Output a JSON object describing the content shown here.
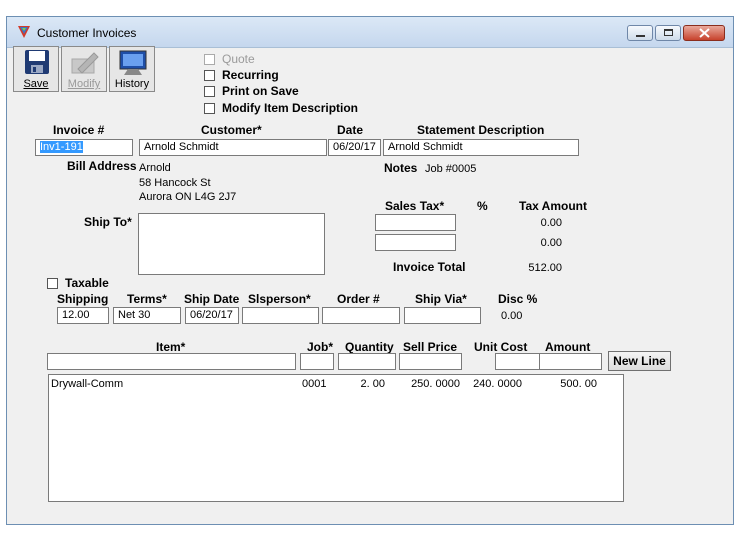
{
  "window": {
    "title": "Customer Invoices"
  },
  "toolbar": {
    "save_label": "Save",
    "modify_label": "Modify",
    "history_label": "History"
  },
  "options": {
    "quote": "Quote",
    "recurring": "Recurring",
    "print_on_save": "Print on Save",
    "modify_item_description": "Modify Item Description"
  },
  "headers": {
    "invoice_no": "Invoice #",
    "customer": "Customer*",
    "date": "Date",
    "statement_description": "Statement Description",
    "bill_address": "Bill Address",
    "notes": "Notes",
    "ship_to": "Ship To*",
    "sales_tax": "Sales Tax*",
    "percent": "%",
    "tax_amount": "Tax Amount",
    "invoice_total": "Invoice Total",
    "taxable": "Taxable",
    "shipping": "Shipping",
    "terms": "Terms*",
    "ship_date": "Ship Date",
    "slsperson": "Slsperson*",
    "order_no": "Order #",
    "ship_via": "Ship Via*",
    "disc_pct": "Disc %"
  },
  "invoice": {
    "invoice_no": "Inv1-191",
    "customer": "Arnold Schmidt",
    "date": "06/20/17",
    "statement_description": "Arnold Schmidt",
    "bill_address": [
      "Arnold",
      "58 Hancock St",
      "Aurora ON L4G 2J7"
    ],
    "notes": "Job #0005",
    "tax_amount_1": "0.00",
    "tax_amount_2": "0.00",
    "invoice_total": "512.00",
    "shipping": "12.00",
    "terms": "Net 30",
    "ship_date": "06/20/17",
    "disc_pct": "0.00"
  },
  "item_headers": {
    "item": "Item*",
    "job": "Job*",
    "quantity": "Quantity",
    "sell_price": "Sell Price",
    "unit_cost": "Unit Cost",
    "amount": "Amount",
    "new_line": "New Line"
  },
  "items": [
    {
      "item": "Drywall-Comm",
      "job": "0001",
      "quantity": "2. 00",
      "sell_price": "250. 0000",
      "unit_cost": "240. 0000",
      "amount": "500. 00"
    }
  ]
}
